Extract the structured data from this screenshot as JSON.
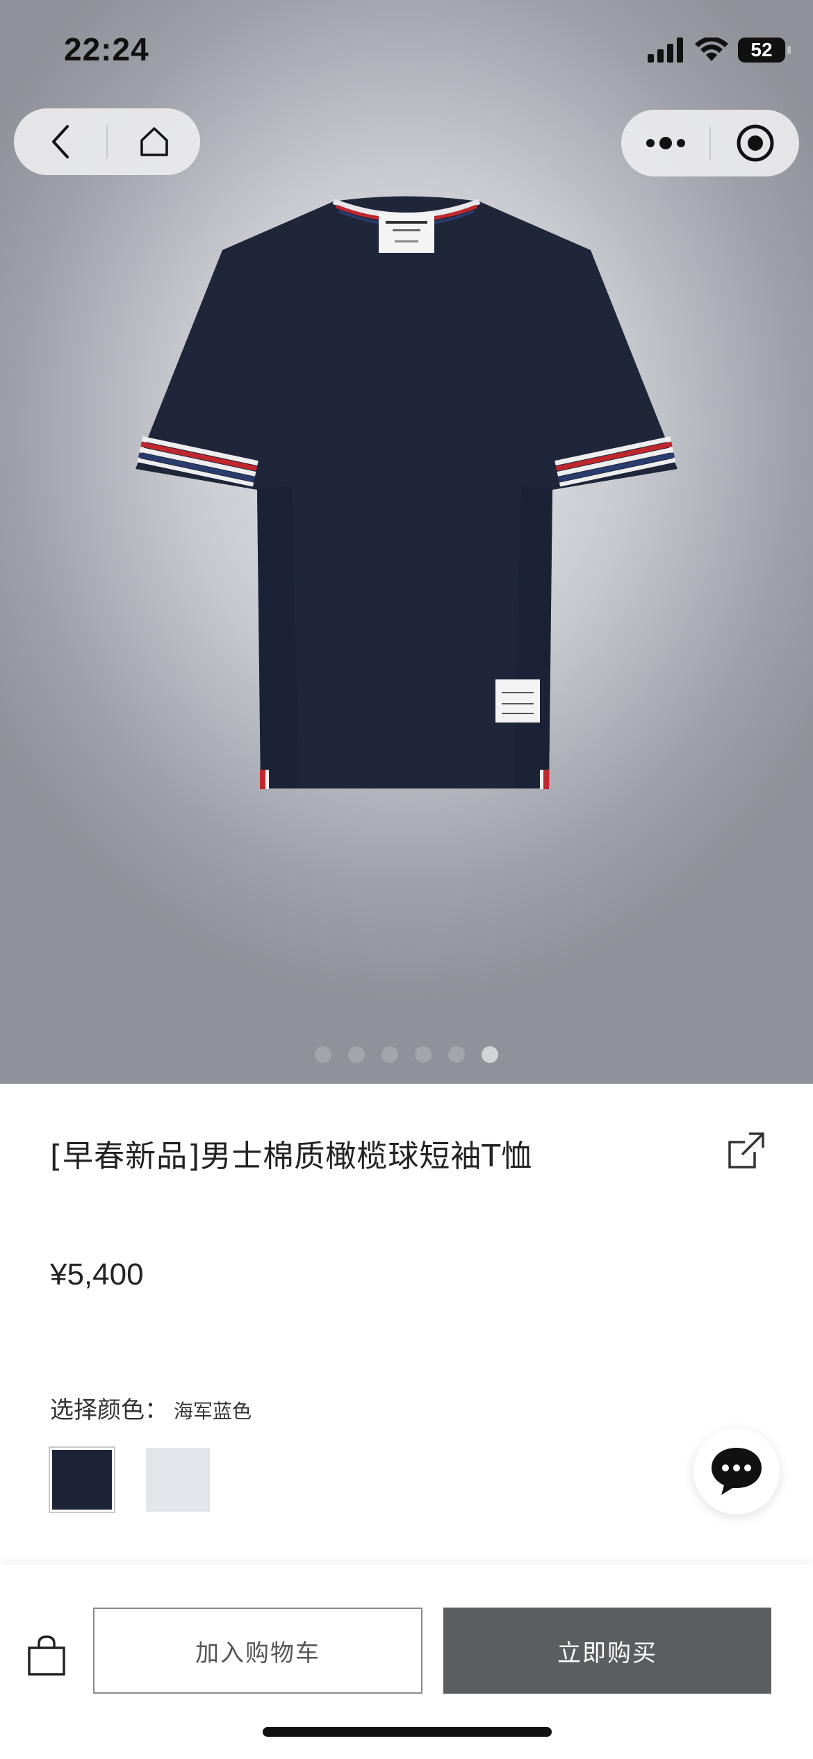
{
  "status_bar": {
    "time": "22:24",
    "battery_level": "52",
    "icons": [
      "signal-icon",
      "wifi-icon",
      "battery-icon"
    ]
  },
  "nav_capsule": {
    "left_icons": [
      "back-icon",
      "home-icon"
    ],
    "right_icons": [
      "more-icon",
      "close-miniprogram-icon"
    ]
  },
  "carousel": {
    "total": 6,
    "active_index": 5
  },
  "product": {
    "title": "[早春新品]男士棉质橄榄球短袖T恤",
    "price": "¥5,400",
    "color_label": "选择颜色：",
    "selected_color": "海军蓝色",
    "swatches": [
      {
        "name": "navy",
        "hex": "#1e2438",
        "selected": true
      },
      {
        "name": "white",
        "hex": "#e4e5eb",
        "selected": false
      }
    ]
  },
  "actions": {
    "add_to_cart": "加入购物车",
    "buy_now": "立即购买"
  },
  "colors": {
    "buy_button": "#5c5d60",
    "shirt_navy": "#1f263a",
    "stripe_red": "#c0262d",
    "stripe_blue": "#2a3b6e"
  }
}
